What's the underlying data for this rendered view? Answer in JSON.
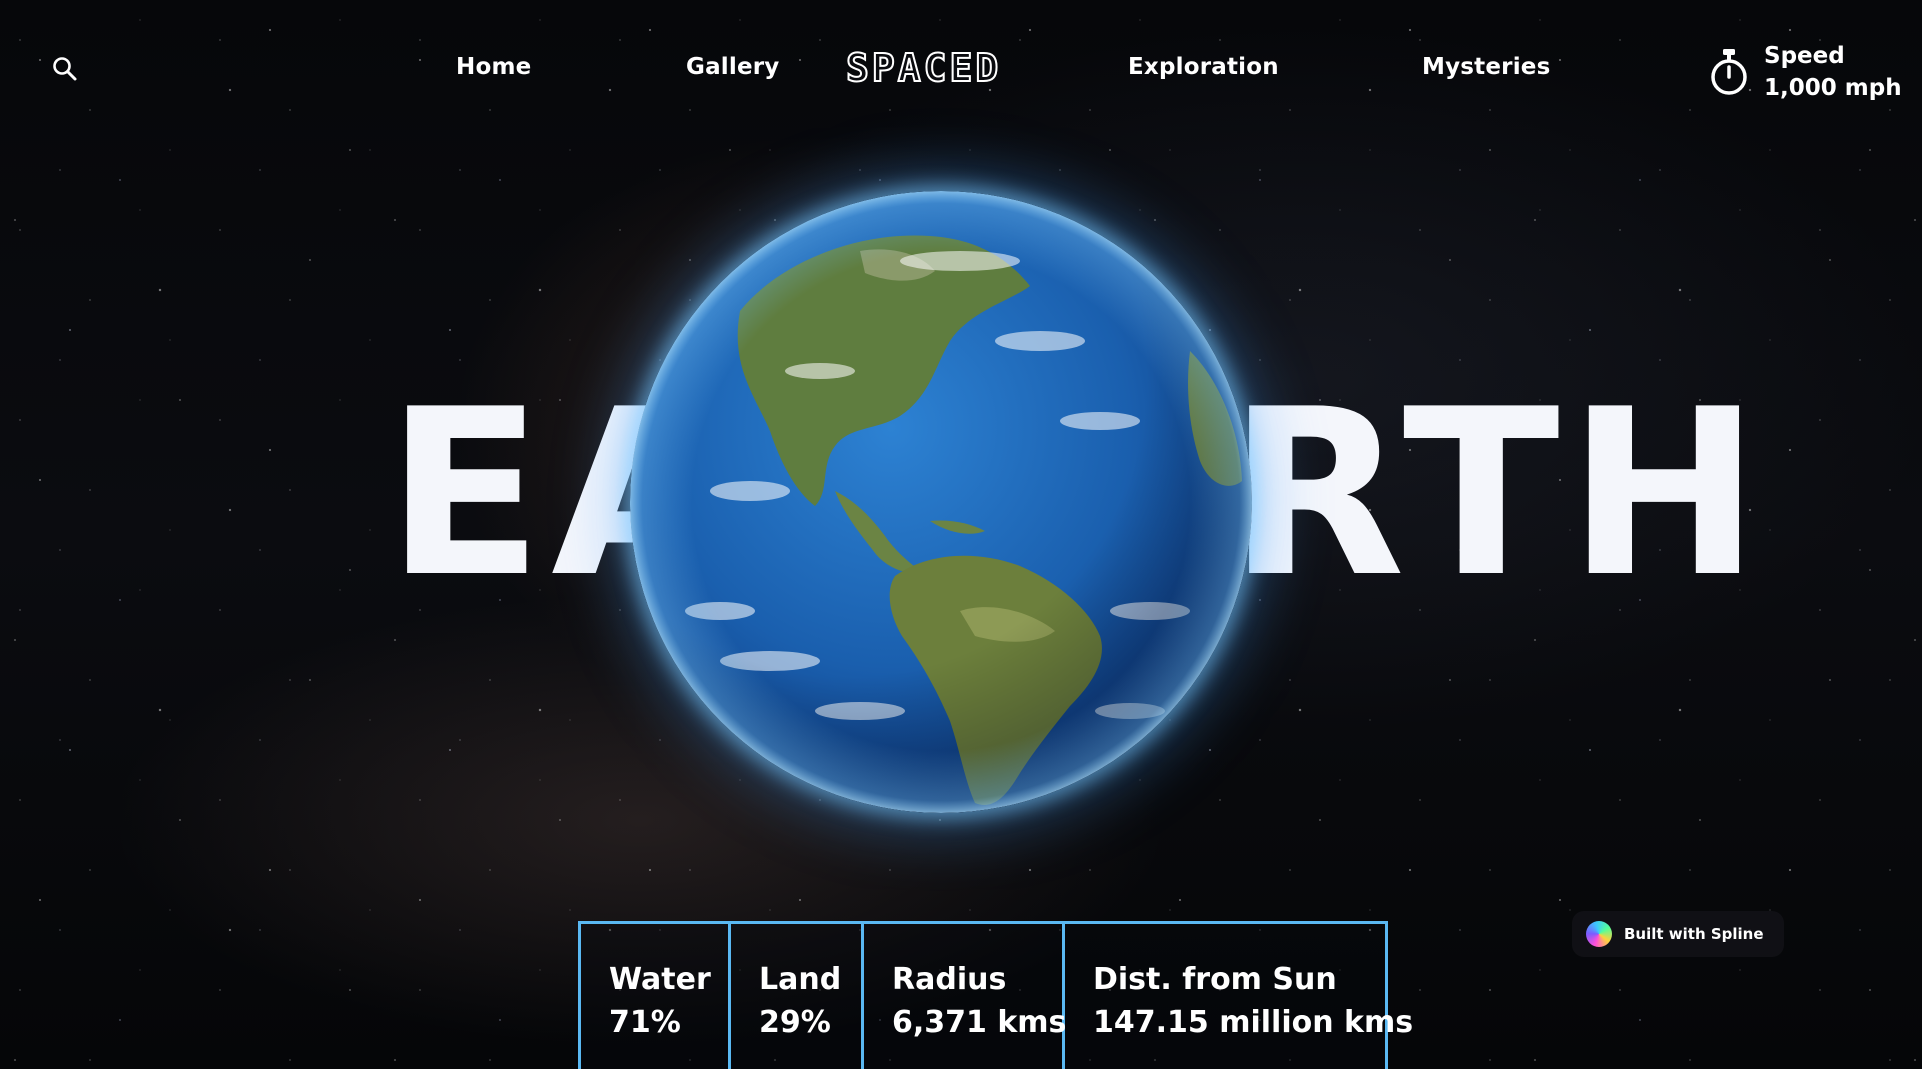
{
  "header": {
    "search_icon": "search-icon",
    "logo_text": "SPACED",
    "nav": [
      {
        "label": "Home"
      },
      {
        "label": "Gallery"
      },
      {
        "label": "Exploration"
      },
      {
        "label": "Mysteries"
      }
    ],
    "speed": {
      "icon": "stopwatch-icon",
      "label": "Speed",
      "value": "1,000 mph"
    }
  },
  "hero": {
    "title_left": "EA",
    "title_right": "RTH",
    "planet_image": "earth-globe"
  },
  "stats": [
    {
      "label": "Water",
      "value": "71%"
    },
    {
      "label": "Land",
      "value": "29%"
    },
    {
      "label": "Radius",
      "value": "6,371 kms"
    },
    {
      "label": "Dist. from Sun",
      "value": "147.15 million kms"
    }
  ],
  "badge": {
    "label": "Built with Spline",
    "icon": "spline-logo-icon"
  },
  "colors": {
    "background": "#050608",
    "accent_border": "#5ab8f2",
    "text": "#ffffff",
    "ocean": "#1f6fc0",
    "land": "#5e7f3e"
  }
}
